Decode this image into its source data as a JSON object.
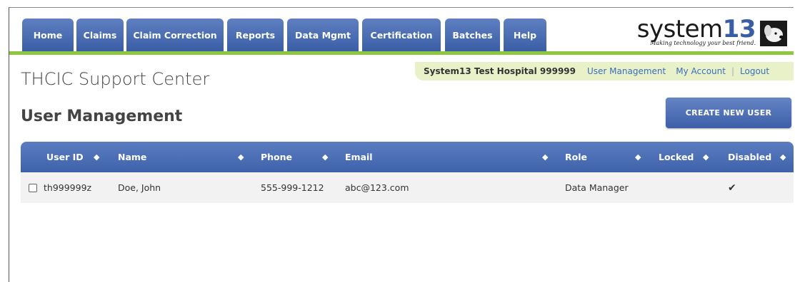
{
  "nav": {
    "tabs": [
      {
        "label": "Home"
      },
      {
        "label": "Claims"
      },
      {
        "label": "Claim Correction"
      },
      {
        "label": "Reports"
      },
      {
        "label": "Data Mgmt"
      },
      {
        "label": "Certification"
      },
      {
        "label": "Batches"
      },
      {
        "label": "Help"
      }
    ]
  },
  "logo": {
    "word": "system",
    "number": "13",
    "tagline": "Making technology your best friend."
  },
  "site_title": "THCIC Support Center",
  "user_bar": {
    "hospital": "System13 Test Hospital 999999",
    "user_management": "User Management",
    "my_account": "My Account",
    "separator": "|",
    "logout": "Logout"
  },
  "page_title": "User Management",
  "create_button": "CREATE NEW USER",
  "table": {
    "columns": [
      "User ID",
      "Name",
      "Phone",
      "Email",
      "Role",
      "Locked",
      "Disabled"
    ],
    "sort_icon": "◆",
    "rows": [
      {
        "user_id": "th999999z",
        "name": "Doe, John",
        "phone": "555-999-1212",
        "email": "abc@123.com",
        "role": "Data Manager",
        "locked": "",
        "disabled": "✔"
      }
    ]
  }
}
